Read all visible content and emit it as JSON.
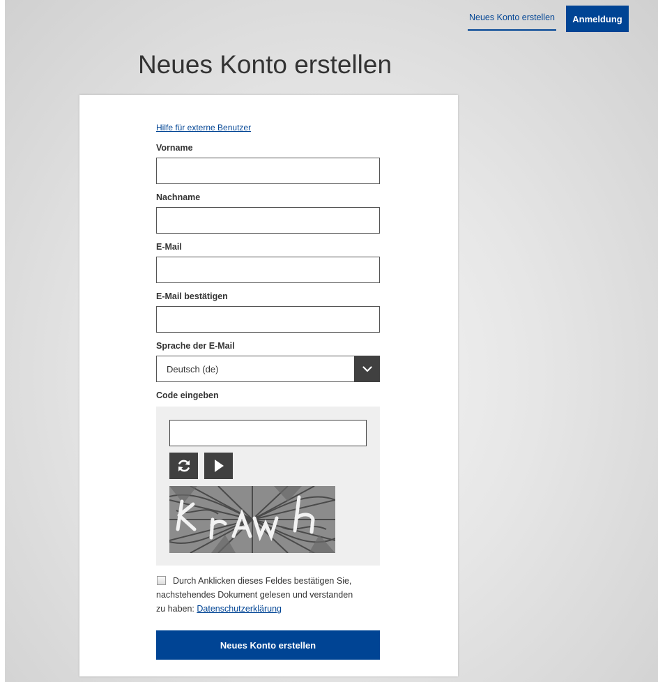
{
  "header": {
    "nav_link": "Neues Konto erstellen",
    "login_button": "Anmeldung"
  },
  "page": {
    "title": "Neues Konto erstellen"
  },
  "form": {
    "help_link": "Hilfe für externe Benutzer",
    "fields": {
      "firstname": {
        "label": "Vorname",
        "value": ""
      },
      "lastname": {
        "label": "Nachname",
        "value": ""
      },
      "email": {
        "label": "E-Mail",
        "value": ""
      },
      "email_confirm": {
        "label": "E-Mail bestätigen",
        "value": ""
      }
    },
    "language": {
      "label": "Sprache der E-Mail",
      "selected": "Deutsch (de)"
    },
    "captcha": {
      "label": "Code eingeben",
      "value": "",
      "refresh_icon": "refresh-icon",
      "play_icon": "play-icon",
      "image_text": "krawh"
    },
    "consent": {
      "line1": "Durch Anklicken dieses Feldes bestätigen Sie,",
      "line2": "nachstehendes Dokument gelesen und verstanden",
      "line3_prefix": "zu haben: ",
      "link": "Datenschutzerklärung",
      "checked": false
    },
    "submit": "Neues Konto erstellen"
  },
  "colors": {
    "primary": "#004494",
    "dark_button": "#404040",
    "title_text": "#333333"
  }
}
